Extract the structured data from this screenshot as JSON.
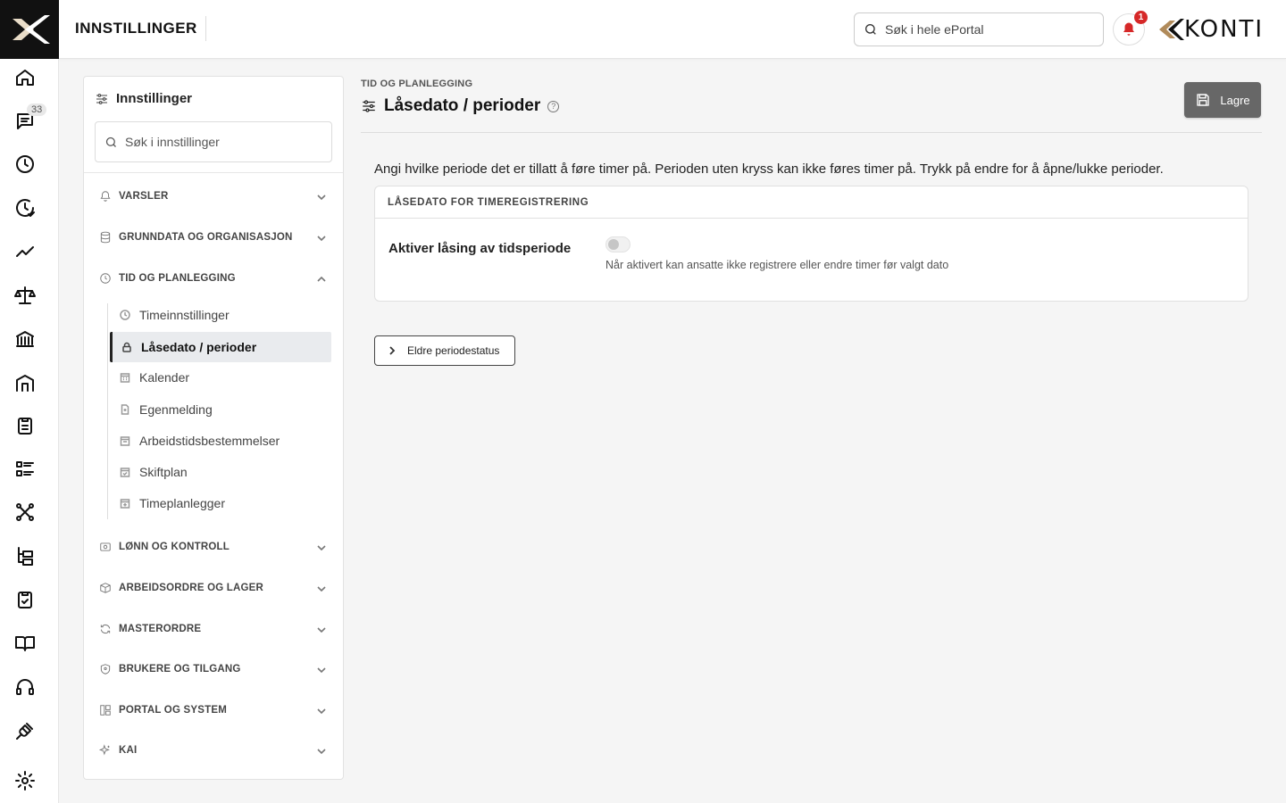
{
  "topbar": {
    "title": "INNSTILLINGER",
    "search_placeholder": "Søk i hele ePortal",
    "notification_count": "1",
    "brand": "KONTI"
  },
  "rail": {
    "messages_badge": "33",
    "icons": [
      "home-icon",
      "messages-icon",
      "clock-icon",
      "time-check-icon",
      "trend-icon",
      "scale-icon",
      "bank-icon",
      "building-icon",
      "clipboard-icon",
      "list-icon",
      "network-icon",
      "hierarchy-icon",
      "clipboard-check-icon",
      "book-icon",
      "headset-icon",
      "plug-icon",
      "settings-icon"
    ]
  },
  "settings_panel": {
    "title": "Innstillinger",
    "search_placeholder": "Søk i innstillinger",
    "sections": {
      "varsler": "VARSLER",
      "grunndata": "GRUNNDATA OG ORGANISASJON",
      "tid": "TID OG PLANLEGGING",
      "lonn": "LØNN OG KONTROLL",
      "arbeidsordre": "ARBEIDSORDRE OG LAGER",
      "masterordre": "MASTERORDRE",
      "brukere": "BRUKERE OG TILGANG",
      "portal": "PORTAL OG SYSTEM",
      "kai": "KAI"
    },
    "tid_items": [
      "Timeinnstillinger",
      "Låsedato / perioder",
      "Kalender",
      "Egenmelding",
      "Arbeidstidsbestemmelser",
      "Skiftplan",
      "Timeplanlegger"
    ],
    "active_item": "Låsedato / perioder"
  },
  "main": {
    "breadcrumb": "TID OG PLANLEGGING",
    "title": "Låsedato / perioder",
    "help_icon": "?",
    "save_label": "Lagre",
    "description": "Angi hvilke periode det er tillatt å føre timer på. Perioden uten kryss kan ikke føres timer på. Trykk på endre for å åpne/lukke perioder.",
    "card": {
      "header": "LÅSEDATO FOR TIMEREGISTRERING",
      "row_label": "Aktiver låsing av tidsperiode",
      "toggle_on": false,
      "hint": "Når aktivert kan ansatte ikke registrere eller endre timer før valgt dato"
    },
    "older_button": "Eldre periodestatus"
  },
  "colors": {
    "accent_dark": "#111111",
    "save_button": "#676767",
    "notification": "#d62828",
    "brand_gold": "#b08a5a"
  }
}
